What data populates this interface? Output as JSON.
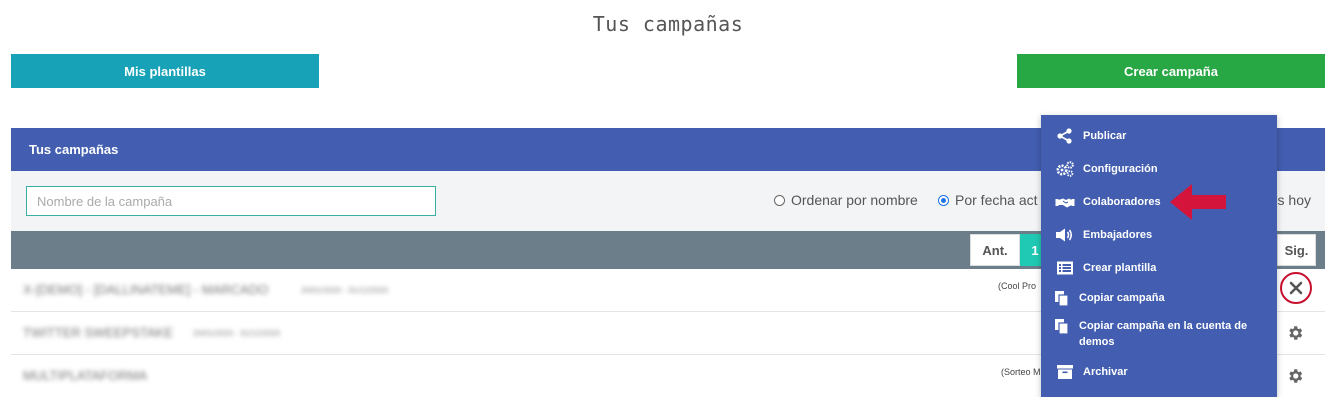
{
  "page": {
    "title": "Tus campañas"
  },
  "toolbar": {
    "templates_label": "Mis plantillas",
    "create_label": "Crear campaña"
  },
  "panel": {
    "title": "Tus campañas"
  },
  "filters": {
    "search_placeholder": "Nombre de la campaña",
    "sort_by_name": "Ordenar por nombre",
    "sort_by_date": "Por fecha act",
    "sort_today_fragment": "s hoy",
    "selected": "date"
  },
  "pagination": {
    "prev_label": "Ant.",
    "current_page": "1",
    "next_label": "Sig."
  },
  "campaigns": [
    {
      "name": "X-[DEMO] - [DALLINATEME] - MARCADO",
      "meta": "20/01/2020 - 31/12/2020",
      "note": "(Cool Pro",
      "action": "close-icon"
    },
    {
      "name": "TWITTER SWEEPSTAKE",
      "meta": "20/01/2020 - 31/12/2020",
      "note": "",
      "action": "gear-icon"
    },
    {
      "name": "MULTIPLATAFORMA",
      "meta": "",
      "note": "(Sorteo M",
      "action": "gear-icon"
    }
  ],
  "context_menu": {
    "items": [
      {
        "label": "Publicar",
        "icon": "share-icon"
      },
      {
        "label": "Configuración",
        "icon": "gears-icon"
      },
      {
        "label": "Colaboradores",
        "icon": "handshake-icon"
      },
      {
        "label": "Embajadores",
        "icon": "megaphone-icon"
      },
      {
        "label": "Crear plantilla",
        "icon": "list-icon"
      },
      {
        "label": "Copiar campaña",
        "icon": "copy-icon"
      },
      {
        "label": "Copiar campaña en la cuenta de demos",
        "icon": "copy-icon"
      },
      {
        "label": "Archivar",
        "icon": "archive-icon"
      }
    ]
  },
  "colors": {
    "accent_blue": "#435eb0",
    "teal": "#17a2b8",
    "green": "#28a745",
    "highlight_red": "#c8102e"
  }
}
